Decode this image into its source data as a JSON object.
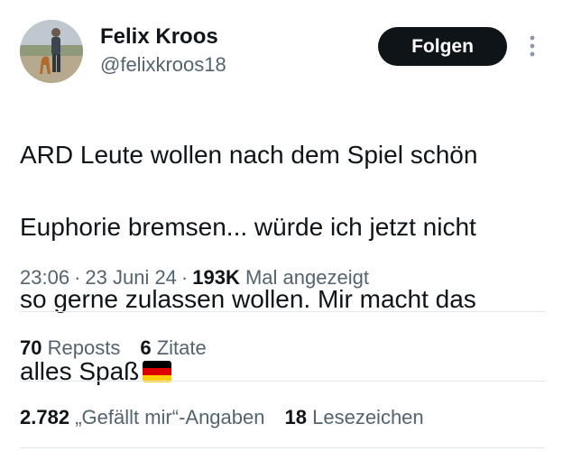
{
  "user": {
    "display_name": "Felix Kroos",
    "handle": "@felixkroos18",
    "avatar_icon": "profile-photo-person-with-dog"
  },
  "follow_button": {
    "label": "Folgen"
  },
  "more_button": {
    "icon": "more-vertical-icon"
  },
  "tweet": {
    "lines": [
      "ARD Leute wollen nach dem Spiel schön",
      "Euphorie bremsen... würde ich jetzt nicht",
      "so gerne zulassen wollen. Mir macht das",
      "alles Spaß"
    ],
    "emoji": "germany-flag"
  },
  "meta": {
    "time": "23:06",
    "separator": "·",
    "date": "23 Juni 24",
    "views_count": "193K",
    "views_label": "Mal angezeigt"
  },
  "stats_row1": {
    "reposts_count": "70",
    "reposts_label": "Reposts",
    "quotes_count": "6",
    "quotes_label": "Zitate"
  },
  "stats_row2": {
    "likes_count": "2.782",
    "likes_label": "„Gefällt mir“-Angaben",
    "bookmarks_count": "18",
    "bookmarks_label": "Lesezeichen"
  },
  "colors": {
    "text_primary": "#0f1419",
    "text_secondary": "#536471",
    "button_bg": "#0f1419",
    "divider": "#e1e6ea",
    "flag_black": "#000000",
    "flag_red": "#dd0000",
    "flag_gold": "#ffce00"
  }
}
